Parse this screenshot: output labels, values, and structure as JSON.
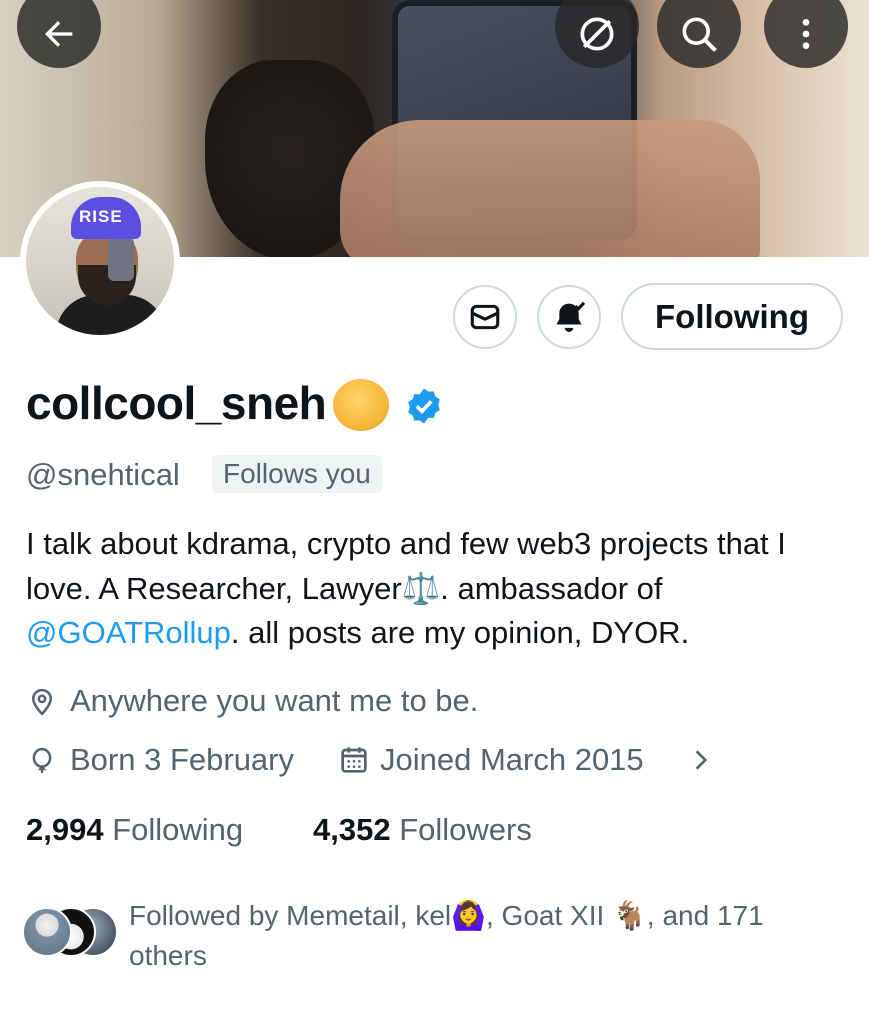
{
  "header": {
    "back_icon": "arrow-left-icon",
    "buttons": [
      "mute-icon",
      "search-icon",
      "more-vertical-icon"
    ]
  },
  "profile": {
    "display_name": "collcool_sneh",
    "name_emoji": "moon-emoji",
    "verified_color": "#1d9bf0",
    "handle": "@snehtical",
    "follows_you_label": "Follows you",
    "bio_part1": "I talk about kdrama, crypto and few web3 projects that I love. A Researcher, Lawyer⚖️. ambassador of ",
    "bio_mention": "@GOATRollup",
    "bio_part2": ". all posts are my opinion, DYOR.",
    "location": "Anywhere you want me to be.",
    "birthday": "Born 3 February",
    "joined": "Joined March 2015",
    "avatar_cap_text": "RISE"
  },
  "actions": {
    "following_label": "Following"
  },
  "stats": {
    "following_count": "2,994",
    "following_label": "Following",
    "followers_count": "4,352",
    "followers_label": "Followers"
  },
  "followed_by": {
    "text": "Followed by Memetail, kel🙆‍♀️, Goat XII 🐐, and 171 others"
  },
  "colors": {
    "accent": "#1d9bf0",
    "text_primary": "#0f1419",
    "text_secondary": "#536471",
    "border": "#cfd9de"
  }
}
